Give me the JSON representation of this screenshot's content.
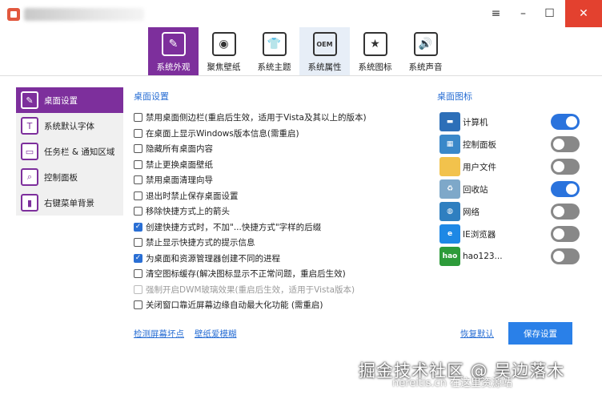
{
  "window": {
    "controls": {
      "menu": "≡",
      "minimize": "–",
      "maximize": "☐",
      "close": "✕"
    }
  },
  "tabs": [
    {
      "label": "系统外观",
      "icon": "brush-icon",
      "glyph": "✎",
      "active": true
    },
    {
      "label": "聚焦壁纸",
      "icon": "focus-icon",
      "glyph": "◉"
    },
    {
      "label": "系统主题",
      "icon": "shirt-icon",
      "glyph": "👕"
    },
    {
      "label": "系统属性",
      "icon": "oem-icon",
      "glyph": "OEM",
      "hover": true
    },
    {
      "label": "系统图标",
      "icon": "star-icon",
      "glyph": "★"
    },
    {
      "label": "系统声音",
      "icon": "speaker-icon",
      "glyph": "🔊"
    }
  ],
  "sidebar": {
    "items": [
      {
        "label": "桌面设置",
        "icon": "desktop-settings-icon",
        "glyph": "✎",
        "active": true
      },
      {
        "label": "系统默认字体",
        "icon": "font-icon",
        "glyph": "T"
      },
      {
        "label": "任务栏 & 通知区域",
        "icon": "taskbar-icon",
        "glyph": "▭"
      },
      {
        "label": "控制面板",
        "icon": "control-panel-icon",
        "glyph": "⌕"
      },
      {
        "label": "右键菜单背景",
        "icon": "context-menu-icon",
        "glyph": "▮"
      }
    ]
  },
  "desktop_settings": {
    "title": "桌面设置",
    "options": [
      {
        "label": "禁用桌面侧边栏(重启后生效，适用于Vista及其以上的版本)",
        "checked": false
      },
      {
        "label": "在桌面上显示Windows版本信息(需重启)",
        "checked": false
      },
      {
        "label": "隐藏所有桌面内容",
        "checked": false
      },
      {
        "label": "禁止更换桌面壁纸",
        "checked": false
      },
      {
        "label": "禁用桌面清理向导",
        "checked": false
      },
      {
        "label": "退出时禁止保存桌面设置",
        "checked": false
      },
      {
        "label": "移除快捷方式上的箭头",
        "checked": false
      },
      {
        "label": "创建快捷方式时，不加\"...快捷方式\"字样的后缀",
        "checked": true
      },
      {
        "label": "禁止显示快捷方式的提示信息",
        "checked": false
      },
      {
        "label": "为桌面和资源管理器创建不同的进程",
        "checked": true
      },
      {
        "label": "清空图标缓存(解决图标显示不正常问题，重启后生效)",
        "checked": false
      },
      {
        "label": "强制开启DWM玻璃效果(重启后生效，适用于Vista版本)",
        "checked": false,
        "disabled": true
      },
      {
        "label": "关闭窗口靠近屏幕边缘自动最大化功能 (需重启)",
        "checked": false
      }
    ]
  },
  "desktop_icons": {
    "title": "桌面图标",
    "items": [
      {
        "label": "计算机",
        "icon": "computer-icon",
        "glyph": "▬",
        "color": "#2d6fb8",
        "on": true
      },
      {
        "label": "控制面板",
        "icon": "control-panel-icon",
        "glyph": "▦",
        "color": "#3a88c9",
        "on": false
      },
      {
        "label": "用户文件",
        "icon": "folder-icon",
        "glyph": "",
        "color": "#f2c24c",
        "on": false
      },
      {
        "label": "回收站",
        "icon": "recycle-bin-icon",
        "glyph": "♻",
        "color": "#7ea8c9",
        "on": true
      },
      {
        "label": "网络",
        "icon": "network-icon",
        "glyph": "◍",
        "color": "#2f7fc0",
        "on": false
      },
      {
        "label": "IE浏览器",
        "icon": "ie-icon",
        "glyph": "e",
        "color": "#1e88e5",
        "on": false
      },
      {
        "label": "hao123...",
        "icon": "hao123-icon",
        "glyph": "hao",
        "color": "#2d9b3a",
        "on": false
      }
    ]
  },
  "footer": {
    "link_check": "检测屏幕坏点",
    "link_wallpaper": "壁纸爱模糊",
    "link_restore": "恢复默认",
    "save_button": "保存设置"
  },
  "watermark": {
    "line1": "掘金技术社区 @ 吴边落木",
    "line2": "nereitis.cn 在这里资源站"
  }
}
